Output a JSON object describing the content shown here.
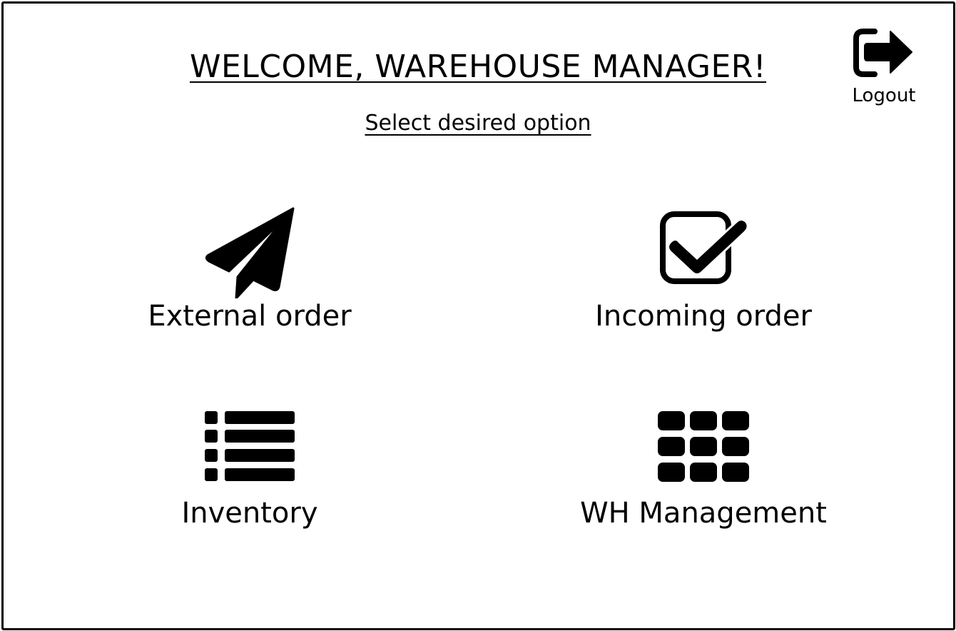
{
  "header": {
    "title": "WELCOME, WAREHOUSE MANAGER!",
    "subtitle": "Select desired option"
  },
  "logout": {
    "label": "Logout",
    "icon": "logout-icon"
  },
  "options": [
    {
      "label": "External order",
      "icon": "paper-plane-icon"
    },
    {
      "label": "Incoming order",
      "icon": "checkbox-checked-icon"
    },
    {
      "label": "Inventory",
      "icon": "list-icon"
    },
    {
      "label": "WH Management",
      "icon": "grid-icon"
    }
  ]
}
